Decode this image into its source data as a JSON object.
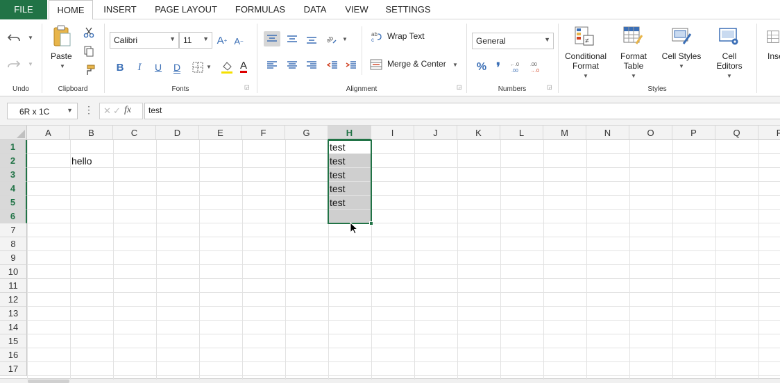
{
  "tabs": {
    "file": "FILE",
    "home": "HOME",
    "insert": "INSERT",
    "page_layout": "PAGE LAYOUT",
    "formulas": "FORMULAS",
    "data": "DATA",
    "view": "VIEW",
    "settings": "SETTINGS"
  },
  "ribbon": {
    "undo_group": "Undo",
    "clipboard_group": "Clipboard",
    "paste_label": "Paste",
    "fonts_group": "Fonts",
    "font_name": "Calibri",
    "font_size": "11",
    "alignment_group": "Alignment",
    "wrap_text": "Wrap Text",
    "merge_center": "Merge & Center",
    "numbers_group": "Numbers",
    "number_format": "General",
    "styles_group": "Styles",
    "conditional_format_line1": "Conditional",
    "conditional_format_line2": "Format",
    "format_table_line1": "Format",
    "format_table_line2": "Table",
    "cell_styles": "Cell Styles",
    "cell_editors_line1": "Cell",
    "cell_editors_line2": "Editors",
    "insert_partial": "Inse"
  },
  "formula_bar": {
    "name_box": "6R x 1C",
    "formula_value": "test"
  },
  "grid": {
    "columns": [
      "A",
      "B",
      "C",
      "D",
      "E",
      "F",
      "G",
      "H",
      "I",
      "J",
      "K",
      "L",
      "M",
      "N",
      "O",
      "P",
      "Q",
      "R"
    ],
    "rows": [
      "1",
      "2",
      "3",
      "4",
      "5",
      "6",
      "7",
      "8",
      "9",
      "10",
      "11",
      "12",
      "13",
      "14",
      "15",
      "16",
      "17"
    ],
    "selected_column": "H",
    "selected_rows": [
      "1",
      "2",
      "3",
      "4",
      "5",
      "6"
    ],
    "cells": {
      "B2": "hello",
      "H1": "test",
      "H2": "test",
      "H3": "test",
      "H4": "test",
      "H5": "test"
    }
  },
  "colors": {
    "accent": "#217346",
    "icon_blue": "#3b6fb6",
    "selection_fill": "#cfcfcf"
  }
}
